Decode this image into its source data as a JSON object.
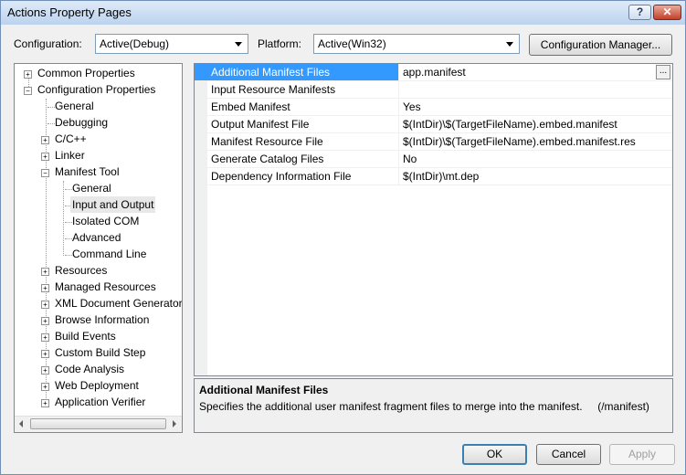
{
  "window": {
    "title": "Actions Property Pages",
    "help_label": "?",
    "close_label": "✕"
  },
  "toolbar": {
    "configuration_label": "Configuration:",
    "configuration_value": "Active(Debug)",
    "platform_label": "Platform:",
    "platform_value": "Active(Win32)",
    "config_manager_label": "Configuration Manager..."
  },
  "tree": {
    "common": "Common Properties",
    "config": "Configuration Properties",
    "general": "General",
    "debugging": "Debugging",
    "cpp": "C/C++",
    "linker": "Linker",
    "manifest_tool": "Manifest Tool",
    "mt_general": "General",
    "mt_input_output": "Input and Output",
    "mt_isolated_com": "Isolated COM",
    "mt_advanced": "Advanced",
    "mt_command_line": "Command Line",
    "resources": "Resources",
    "managed_resources": "Managed Resources",
    "xml_doc": "XML Document Generator",
    "browse_info": "Browse Information",
    "build_events": "Build Events",
    "custom_build": "Custom Build Step",
    "code_analysis": "Code Analysis",
    "web_deploy": "Web Deployment",
    "app_verifier": "Application Verifier"
  },
  "grid": {
    "rows": [
      {
        "name": "Additional Manifest Files",
        "value": "app.manifest"
      },
      {
        "name": "Input Resource Manifests",
        "value": ""
      },
      {
        "name": "Embed Manifest",
        "value": "Yes"
      },
      {
        "name": "Output Manifest File",
        "value": "$(IntDir)\\$(TargetFileName).embed.manifest"
      },
      {
        "name": "Manifest Resource File",
        "value": "$(IntDir)\\$(TargetFileName).embed.manifest.res"
      },
      {
        "name": "Generate Catalog Files",
        "value": "No"
      },
      {
        "name": "Dependency Information File",
        "value": "$(IntDir)\\mt.dep"
      }
    ],
    "ellipsis": "..."
  },
  "description": {
    "heading": "Additional Manifest Files",
    "text": "Specifies the additional user manifest fragment files to merge into the manifest.     (/manifest)"
  },
  "buttons": {
    "ok": "OK",
    "cancel": "Cancel",
    "apply": "Apply"
  }
}
